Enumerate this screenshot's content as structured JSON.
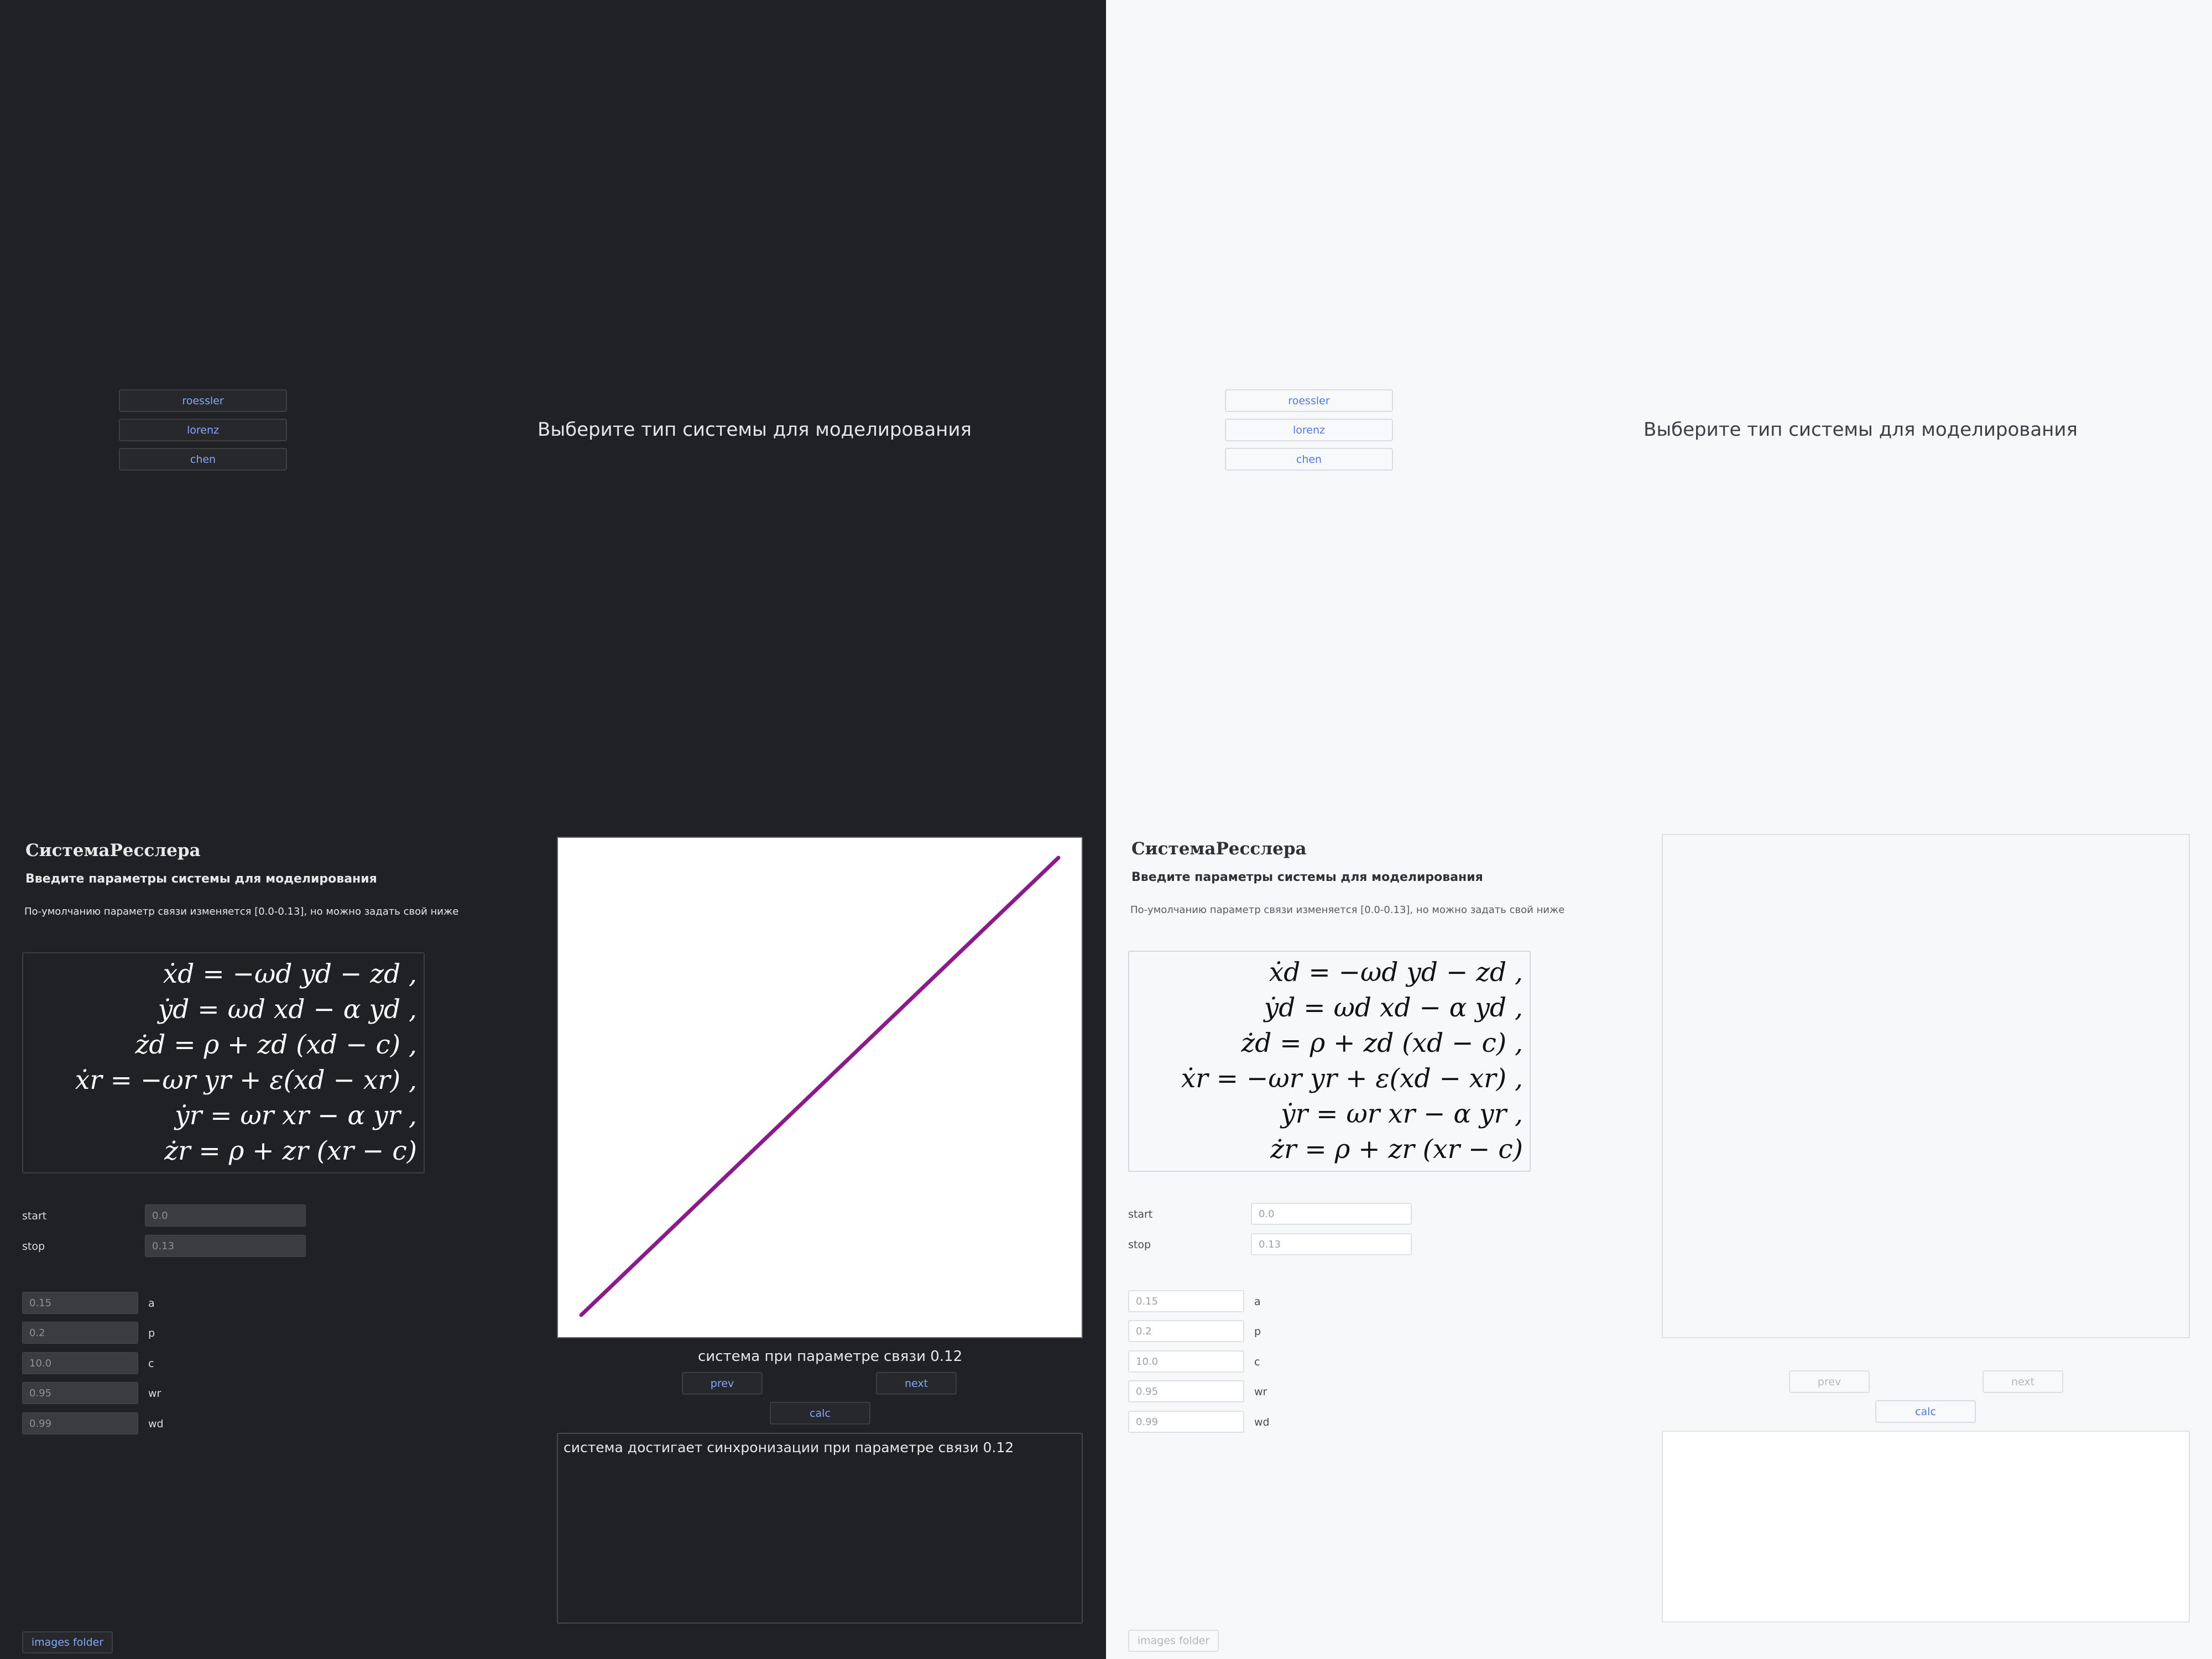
{
  "menu": {
    "buttons": [
      "roessler",
      "lorenz",
      "chen"
    ],
    "prompt": "Выберите тип системы для моделирования"
  },
  "system": {
    "title": "СистемаРесслера",
    "subtitle": "Введите параметры системы для моделирования",
    "note": "По-умолчанию параметр связи изменяется [0.0-0.13], но можно задать свой ниже",
    "equations": [
      "ẋd = −ωd yd − zd ,",
      "ẏd = ωd xd − α yd ,",
      "żd = ρ + zd (xd − c) ,",
      "ẋr = −ωr yr + ε(xd − xr) ,",
      "ẏr = ωr xr − α yr ,",
      "żr = ρ + zr (xr − c)"
    ],
    "range": {
      "start_label": "start",
      "start_value": "0.0",
      "stop_label": "stop",
      "stop_value": "0.13"
    },
    "params": [
      {
        "value": "0.15",
        "label": "a"
      },
      {
        "value": "0.2",
        "label": "p"
      },
      {
        "value": "10.0",
        "label": "c"
      },
      {
        "value": "0.95",
        "label": "wr"
      },
      {
        "value": "0.99",
        "label": "wd"
      }
    ]
  },
  "result": {
    "caption": "система при параметре связи 0.12",
    "prev_label": "prev",
    "next_label": "next",
    "calc_label": "calc",
    "output_text": "система достигает синхронизации при параметре связи 0.12",
    "images_folder_label": "images folder"
  },
  "chart_data": {
    "type": "line",
    "series": [
      {
        "x": [
          0,
          1
        ],
        "y": [
          0,
          1
        ],
        "color": "#8b1a8b"
      }
    ],
    "grid": false
  },
  "colors": {
    "dark_bg": "#202124",
    "light_bg": "#f7f8fa",
    "accent_dark": "#86a8ff",
    "accent_light": "#4f77e3",
    "plot_line": "#8b1a8b"
  }
}
